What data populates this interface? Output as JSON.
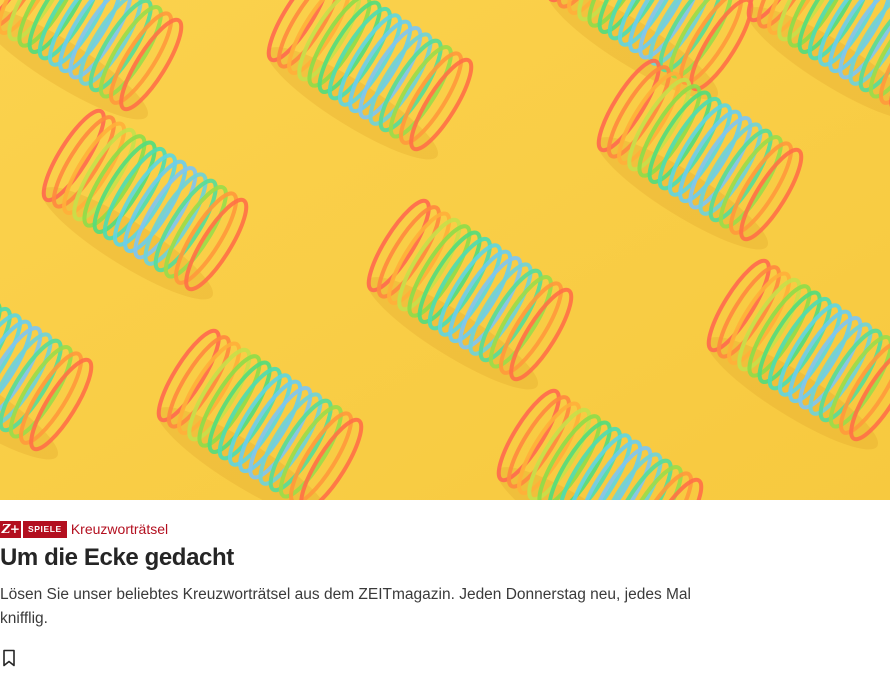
{
  "hero": {
    "alt_icon": "slinky-springs-image",
    "background_color": "#f9ce45"
  },
  "teaser": {
    "premium_badge": "Z+",
    "tag": "SPIELE",
    "kicker": "Kreuzworträtsel",
    "title": "Um die Ecke gedacht",
    "description": "Lösen Sie unser beliebtes Kreuzworträtsel aus dem ZEITmagazin. Jeden Donnerstag neu, jedes Mal knifflig."
  },
  "actions": {
    "bookmark_icon": "bookmark-icon"
  },
  "colors": {
    "accent": "#b30f1f",
    "title": "#252525",
    "text": "#3a3a3a"
  }
}
